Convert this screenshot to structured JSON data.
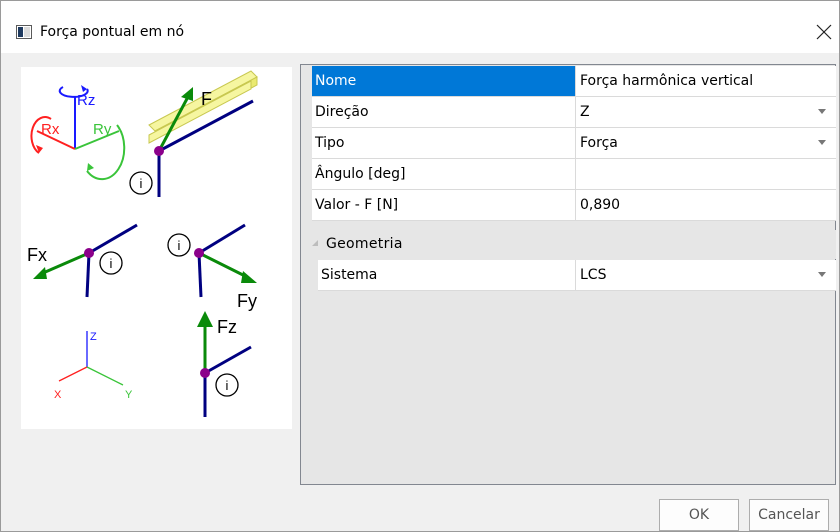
{
  "window": {
    "title": "Força pontual em nó"
  },
  "sketch": {
    "labels": {
      "rz": "Rz",
      "rx": "Rx",
      "ry": "Ry",
      "f": "F",
      "fx": "Fx",
      "fy": "Fy",
      "fz": "Fz",
      "info": "i",
      "axis_z": "Z",
      "axis_x": "X",
      "axis_y": "Y"
    },
    "colors": {
      "rz": "#1a1aff",
      "rx": "#ff2020",
      "ry": "#3ac43a",
      "force": "#0a8a0a",
      "member": "#000080",
      "node": "#8b008b",
      "beam": "#e8e860"
    }
  },
  "grid": {
    "rows": [
      {
        "name": "Nome",
        "value": "Força harmônica vertical",
        "selected": true
      },
      {
        "name": "Direção",
        "value": "Z",
        "dropdown": true
      },
      {
        "name": "Tipo",
        "value": "Força",
        "dropdown": true
      },
      {
        "name": "Ângulo [deg]",
        "value": ""
      },
      {
        "name": "Valor - F [N]",
        "value": "0,890"
      }
    ],
    "category": {
      "label": "Geometria",
      "rows": [
        {
          "name": "Sistema",
          "value": "LCS",
          "dropdown": true
        }
      ]
    },
    "colors": {
      "selection": "#0078d7",
      "category_bg": "#e6e6e6"
    }
  },
  "buttons": {
    "ok": "OK",
    "cancel": "Cancelar"
  }
}
